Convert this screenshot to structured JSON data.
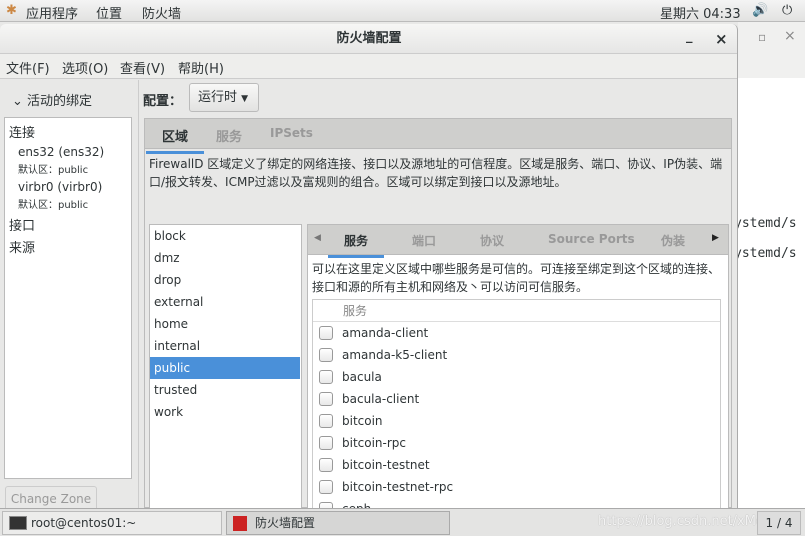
{
  "topbar": {
    "apps": "应用程序",
    "places": "位置",
    "app": "防火墙",
    "clock": "星期六 04:33"
  },
  "window": {
    "title": "防火墙配置",
    "minimize": "_",
    "close": "×"
  },
  "background_window": {
    "maximize": "▫",
    "close": "×",
    "terminal_lines": [
      "ystemd/s",
      "ystemd/s"
    ]
  },
  "menu": [
    "文件(F)",
    "选项(O)",
    "查看(V)",
    "帮助(H)"
  ],
  "left": {
    "header": "活动的绑定",
    "sections": {
      "connections": "连接",
      "interfaces": "接口",
      "sources": "来源"
    },
    "connections": [
      {
        "name": "ens32 (ens32)",
        "zone": "默认区：public"
      },
      {
        "name": "virbr0 (virbr0)",
        "zone": "默认区：public"
      }
    ],
    "change_zone": "Change Zone"
  },
  "config": {
    "label": "配置：",
    "value": "运行时"
  },
  "tabs": [
    "区域",
    "服务",
    "IPSets"
  ],
  "zones_desc": "FirewallD 区域定义了绑定的网络连接、接口以及源地址的可信程度。区域是服务、端口、协议、IP伪装、端口/报文转发、ICMP过滤以及富规则的组合。区域可以绑定到接口以及源地址。",
  "zones": [
    "block",
    "dmz",
    "drop",
    "external",
    "home",
    "internal",
    "public",
    "trusted",
    "work"
  ],
  "selected_zone": "public",
  "subtabs": [
    "服务",
    "端口",
    "协议",
    "Source Ports",
    "伪装"
  ],
  "services_desc": "可以在这里定义区域中哪些服务是可信的。可连接至绑定到这个区域的连接、接口和源的所有主机和网络及丶可以访问可信服务。",
  "services_header": "服务",
  "services": [
    "amanda-client",
    "amanda-k5-client",
    "bacula",
    "bacula-client",
    "bitcoin",
    "bitcoin-rpc",
    "bitcoin-testnet",
    "bitcoin-testnet-rpc",
    "ceph"
  ],
  "taskbar": {
    "items": [
      "root@centos01:~",
      "防火墙配置"
    ],
    "pager": "1 / 4",
    "watermark": "https://blog.csdn.net/xMoeX"
  },
  "colors": {
    "accent": "#4a90d9"
  }
}
